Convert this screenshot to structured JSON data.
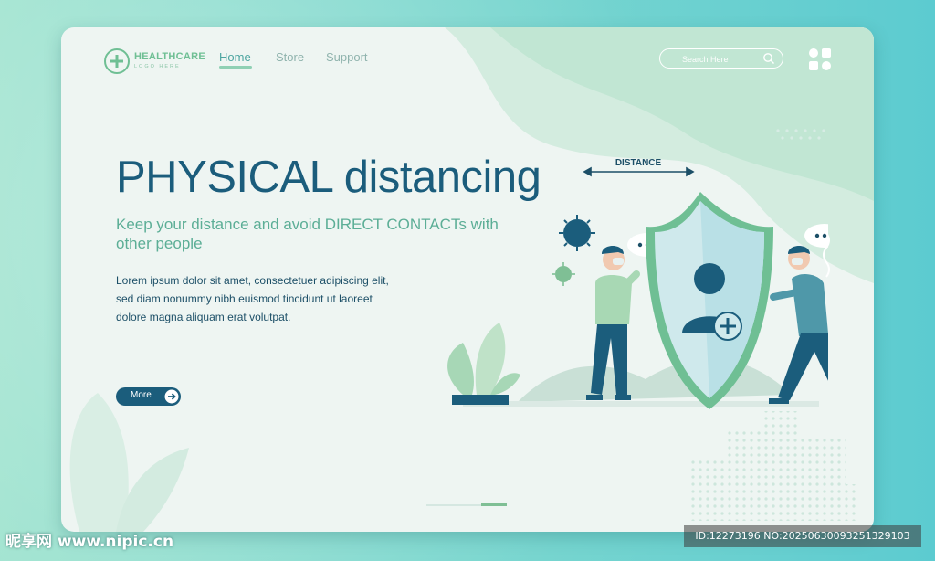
{
  "brand": {
    "name": "HEALTHCARE",
    "tagline": "LOGO HERE"
  },
  "nav": {
    "items": [
      {
        "label": "Home"
      },
      {
        "label": "Store"
      },
      {
        "label": "Support"
      }
    ]
  },
  "search": {
    "placeholder": "Search Here"
  },
  "hero": {
    "title_part1": "PHYSICAL",
    "title_part2": "distancing",
    "subtitle": "Keep your distance and avoid DIRECT CONTACTs with other people",
    "body": "Lorem ipsum dolor sit amet, consectetuer adipiscing elit, sed diam nonummy nibh euismod tincidunt ut laoreet dolore magna aliquam erat volutpat.",
    "more_label": "More"
  },
  "illustration": {
    "distance_label": "DISTANCE"
  },
  "watermarks": {
    "left": "昵享网 www.nipic.cn",
    "right": "ID:12273196 NO:20250630093251329103"
  },
  "colors": {
    "primary": "#1b5d7c",
    "accent": "#6fbf94",
    "background": "#eef5f2"
  },
  "icons": [
    "plus-cross-icon",
    "search-icon",
    "grid-menu-icon",
    "arrow-right-icon",
    "shield-icon",
    "virus-icon",
    "speech-bubble-icon"
  ]
}
